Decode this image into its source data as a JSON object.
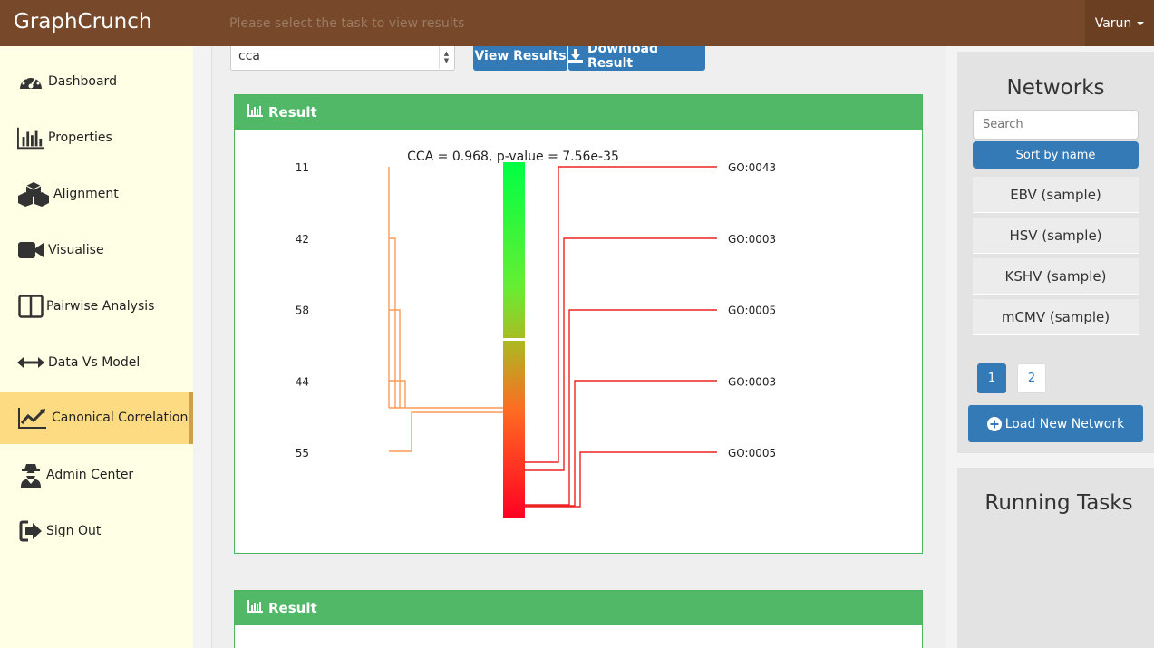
{
  "app": {
    "brand": "GraphCrunch",
    "user": "Varun"
  },
  "sidebar": {
    "items": [
      {
        "label": "Dashboard",
        "icon": "dashboard-icon"
      },
      {
        "label": "Properties",
        "icon": "bar-chart-icon"
      },
      {
        "label": "Alignment",
        "icon": "cubes-icon"
      },
      {
        "label": "Visualise",
        "icon": "video-camera-icon"
      },
      {
        "label": "Pairwise Analysis",
        "icon": "columns-icon"
      },
      {
        "label": "Data Vs Model",
        "icon": "double-arrow-icon"
      },
      {
        "label": "Canonical Correlation",
        "icon": "line-chart-icon",
        "active": true
      },
      {
        "label": "Admin Center",
        "icon": "user-secret-icon"
      },
      {
        "label": "Sign Out",
        "icon": "sign-out-icon"
      }
    ]
  },
  "toolbar": {
    "hint": "Please select the task to view results",
    "selected_task": "cca",
    "view_label": "View Results",
    "download_label": "Download Result"
  },
  "result_panels": [
    {
      "title": "Result"
    },
    {
      "title": "Result"
    }
  ],
  "chart_data": {
    "type": "cca-dendrogram",
    "title": "CCA = 0.968, p-value = 7.56e-35",
    "left_labels": [
      "11",
      "42",
      "58",
      "44",
      "55"
    ],
    "right_labels": [
      "GO:0043",
      "GO:0003",
      "GO:0005",
      "GO:0003",
      "GO:0005"
    ],
    "colorbar": [
      "#00ff44",
      "#ff0022"
    ]
  },
  "networks": {
    "title": "Networks",
    "search_placeholder": "Search",
    "sort_label": "Sort by name",
    "items": [
      "EBV (sample)",
      "HSV (sample)",
      "KSHV (sample)",
      "mCMV (sample)"
    ],
    "pages": [
      "1",
      "2"
    ],
    "current_page": "1",
    "load_label": "Load New Network"
  },
  "running_tasks": {
    "title": "Running Tasks"
  },
  "colors": {
    "topbar": "#77492a",
    "sidebar": "#ffffe5",
    "active": "#fddb82",
    "primary": "#337ab7",
    "panel": "#51b868"
  }
}
